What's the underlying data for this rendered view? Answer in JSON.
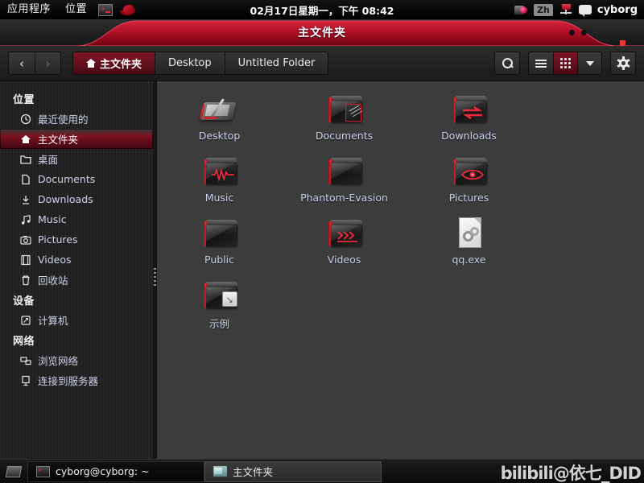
{
  "top_panel": {
    "menus": [
      "应用程序",
      "位置"
    ],
    "launchers": [
      "terminal-icon",
      "fedora-hat-icon"
    ],
    "datetime": "02月17日星期一，下午 08:42",
    "tray": {
      "camera_icon": "camera-icon",
      "input_method": "Zh",
      "volume_icon": "volume-icon",
      "message_icon": "message-bubble-icon",
      "user": "cyborg"
    }
  },
  "window": {
    "title": "主文件夹",
    "titlebar_accent": "#c9122a"
  },
  "toolbar": {
    "back_label": "‹",
    "forward_label": "›",
    "breadcrumbs": [
      {
        "label": "主文件夹",
        "active": true,
        "icon": "home-icon"
      },
      {
        "label": "Desktop",
        "active": false,
        "icon": ""
      },
      {
        "label": "Untitled Folder",
        "active": false,
        "icon": ""
      }
    ],
    "buttons": [
      {
        "name": "search-button",
        "icon": "search-icon",
        "active": false
      },
      {
        "name": "list-view-button",
        "icon": "list-icon",
        "active": false
      },
      {
        "name": "grid-view-button",
        "icon": "grid-icon",
        "active": true
      },
      {
        "name": "view-options-button",
        "icon": "chevron-down-icon",
        "active": false
      },
      {
        "name": "settings-button",
        "icon": "gear-icon",
        "active": false
      }
    ]
  },
  "sidebar": {
    "groups": [
      {
        "title": "位置",
        "items": [
          {
            "label": "最近使用的",
            "icon": "clock-icon",
            "selected": false
          },
          {
            "label": "主文件夹",
            "icon": "home-icon",
            "selected": true
          },
          {
            "label": "桌面",
            "icon": "folder-icon",
            "selected": false
          },
          {
            "label": "Documents",
            "icon": "document-icon",
            "selected": false
          },
          {
            "label": "Downloads",
            "icon": "download-icon",
            "selected": false
          },
          {
            "label": "Music",
            "icon": "music-note-icon",
            "selected": false
          },
          {
            "label": "Pictures",
            "icon": "camera-icon",
            "selected": false
          },
          {
            "label": "Videos",
            "icon": "film-icon",
            "selected": false
          },
          {
            "label": "回收站",
            "icon": "trash-icon",
            "selected": false
          }
        ]
      },
      {
        "title": "设备",
        "items": [
          {
            "label": "计算机",
            "icon": "computer-icon",
            "selected": false
          }
        ]
      },
      {
        "title": "网络",
        "items": [
          {
            "label": "浏览网络",
            "icon": "network-icon",
            "selected": false
          },
          {
            "label": "连接到服务器",
            "icon": "server-icon",
            "selected": false
          }
        ]
      }
    ]
  },
  "content": {
    "files": [
      {
        "label": "Desktop",
        "icon": "desktop-tablet-icon",
        "kind": "tablet"
      },
      {
        "label": "Documents",
        "icon": "documents-folder-icon",
        "kind": "folder-doc"
      },
      {
        "label": "Downloads",
        "icon": "downloads-folder-icon",
        "kind": "folder-arrows"
      },
      {
        "label": "Music",
        "icon": "music-folder-icon",
        "kind": "folder-wave"
      },
      {
        "label": "Phantom-Evasion",
        "icon": "folder-icon",
        "kind": "folder-plain"
      },
      {
        "label": "Pictures",
        "icon": "pictures-folder-icon",
        "kind": "folder-eye"
      },
      {
        "label": "Public",
        "icon": "folder-icon",
        "kind": "folder-plain"
      },
      {
        "label": "Videos",
        "icon": "videos-folder-icon",
        "kind": "folder-chevrons"
      },
      {
        "label": "qq.exe",
        "icon": "executable-file-icon",
        "kind": "file-exe"
      },
      {
        "label": "示例",
        "icon": "symlink-folder-icon",
        "kind": "folder-link"
      }
    ]
  },
  "taskbar": {
    "show_desktop_icon": "show-desktop-icon",
    "items": [
      {
        "label": "cyborg@cyborg: ~",
        "icon": "terminal-icon",
        "active": false
      },
      {
        "label": "主文件夹",
        "icon": "folder-icon",
        "active": true
      }
    ],
    "watermark": "bilibili@依七_DID"
  }
}
